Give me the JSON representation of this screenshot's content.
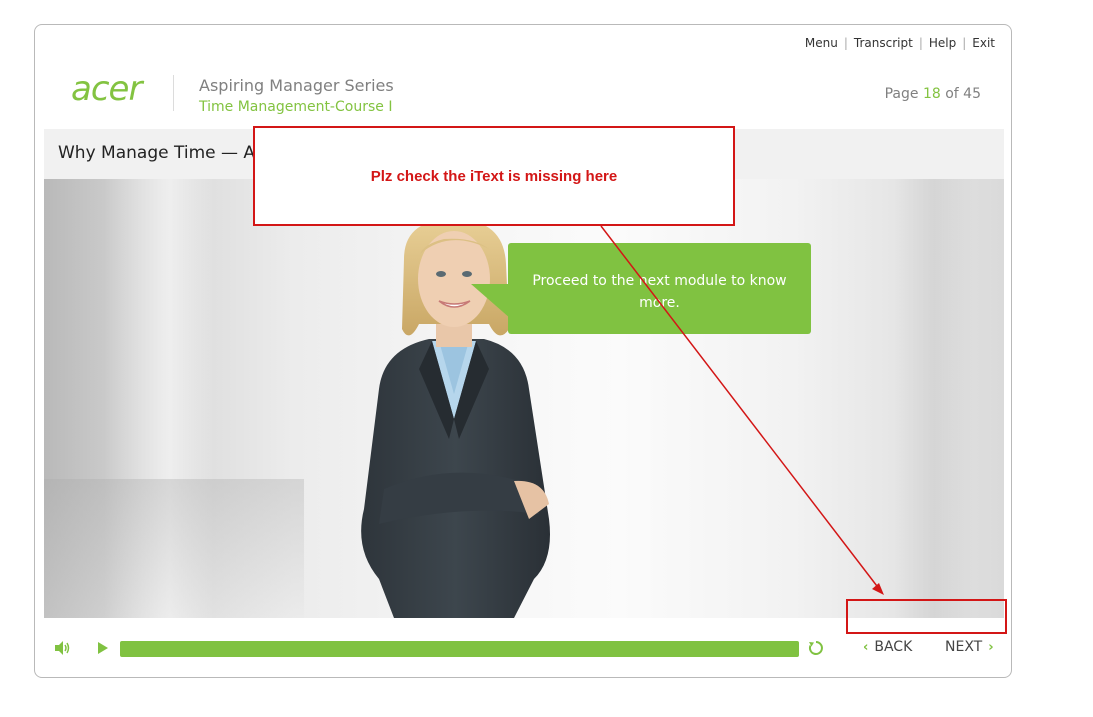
{
  "topnav": {
    "items": [
      "Menu",
      "Transcript",
      "Help",
      "Exit"
    ],
    "separator": "|"
  },
  "header": {
    "logo": "acer",
    "series_title": "Aspiring Manager Series",
    "course_title": "Time Management-Course I",
    "page_label": "Page",
    "page_current": "18",
    "page_of": "of",
    "page_total": "45"
  },
  "slide": {
    "title": "Why Manage Time — A"
  },
  "speech_bubble": {
    "text": "Proceed to the next module to know more."
  },
  "annotation": {
    "note": "Plz check the iText is missing here"
  },
  "controls": {
    "progress_fraction": 1.0,
    "back_label": "BACK",
    "next_label": "NEXT"
  },
  "colors": {
    "brand_green": "#80c241",
    "annotation_red": "#d31616",
    "border_gray": "#b9b9b9"
  },
  "icons": [
    "volume-icon",
    "play-icon",
    "replay-icon",
    "chevron-left-icon",
    "chevron-right-icon"
  ]
}
